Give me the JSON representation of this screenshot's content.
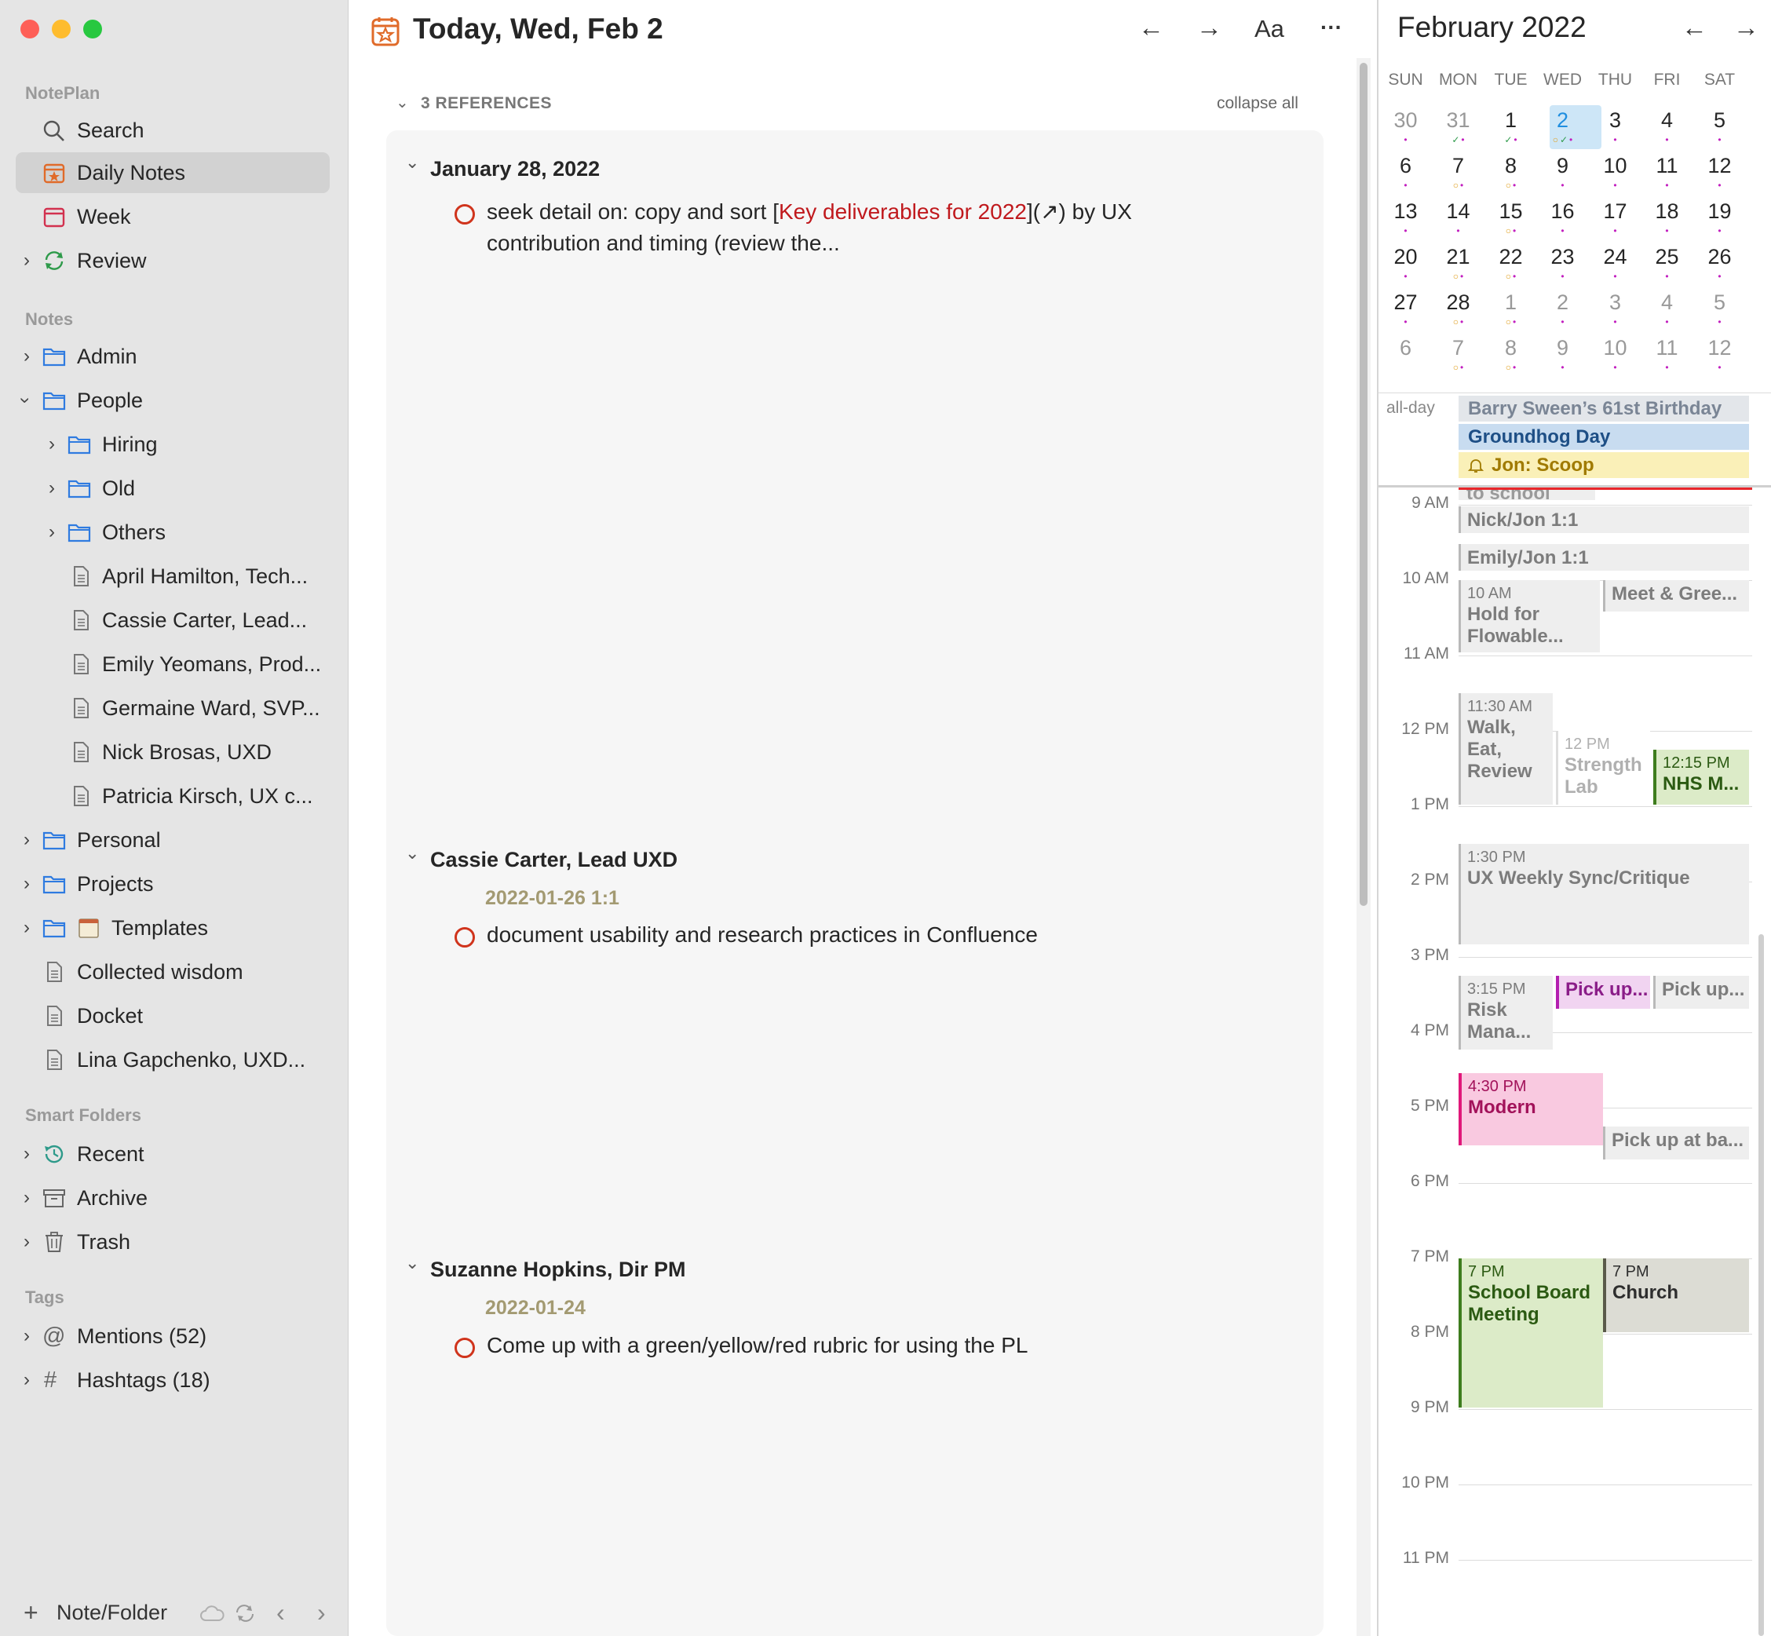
{
  "sidebar": {
    "app_section": "NotePlan",
    "top_items": [
      {
        "label": "Search"
      },
      {
        "label": "Daily Notes"
      },
      {
        "label": "Week"
      },
      {
        "label": "Review"
      }
    ],
    "notes_section": "Notes",
    "note_items": [
      {
        "label": "Admin"
      },
      {
        "label": "People"
      },
      {
        "label": "Hiring"
      },
      {
        "label": "Old"
      },
      {
        "label": "Others"
      },
      {
        "label": "April Hamilton, Tech..."
      },
      {
        "label": "Cassie Carter, Lead..."
      },
      {
        "label": "Emily Yeomans, Prod..."
      },
      {
        "label": "Germaine Ward, SVP..."
      },
      {
        "label": "Nick Brosas, UXD"
      },
      {
        "label": "Patricia Kirsch, UX c..."
      },
      {
        "label": "Personal"
      },
      {
        "label": "Projects"
      },
      {
        "label": "Templates"
      },
      {
        "label": "Collected wisdom"
      },
      {
        "label": "Docket"
      },
      {
        "label": "Lina Gapchenko, UXD..."
      }
    ],
    "smart_section": "Smart Folders",
    "smart_items": [
      {
        "label": "Recent"
      },
      {
        "label": "Archive"
      },
      {
        "label": "Trash"
      }
    ],
    "tags_section": "Tags",
    "tag_items": [
      {
        "label": "Mentions (52)"
      },
      {
        "label": "Hashtags (18)"
      }
    ],
    "footer_label": "Note/Folder"
  },
  "main": {
    "title": "Today, Wed, Feb 2",
    "font_button": "Aa",
    "more_button": "···",
    "references_label": "3 REFERENCES",
    "collapse_all": "collapse all",
    "refs": [
      {
        "heading": "January 28, 2022",
        "task_prefix": "seek detail on: copy and sort [",
        "task_link": "Key deliverables for 2022",
        "task_suffix": "](↗) by UX",
        "task_line2": "contribution and timing (review the..."
      },
      {
        "heading": "Cassie Carter, Lead UXD",
        "date": "2022-01-26 1:1",
        "task": "document usability and research practices in Confluence"
      },
      {
        "heading": "Suzanne Hopkins, Dir PM",
        "date": "2022-01-24",
        "task": "Come up with a green/yellow/red rubric for using the PL"
      }
    ]
  },
  "calendar": {
    "month": "February 2022",
    "dow": [
      "SUN",
      "MON",
      "TUE",
      "WED",
      "THU",
      "FRI",
      "SAT"
    ],
    "weeks": [
      [
        "30",
        "31",
        "1",
        "2",
        "3",
        "4",
        "5"
      ],
      [
        "6",
        "7",
        "8",
        "9",
        "10",
        "11",
        "12"
      ],
      [
        "13",
        "14",
        "15",
        "16",
        "17",
        "18",
        "19"
      ],
      [
        "20",
        "21",
        "22",
        "23",
        "24",
        "25",
        "26"
      ],
      [
        "27",
        "28",
        "1",
        "2",
        "3",
        "4",
        "5"
      ],
      [
        "6",
        "7",
        "8",
        "9",
        "10",
        "11",
        "12"
      ]
    ],
    "today": "2",
    "allday_label": "all-day",
    "allday_events": [
      {
        "title": "Barry Sween’s 61st Birthday"
      },
      {
        "title": "Groundhog Day"
      },
      {
        "title": "Jon: Scoop"
      }
    ],
    "partial_event": "to school",
    "hours": [
      "9 AM",
      "10 AM",
      "11 AM",
      "12 PM",
      "1 PM",
      "2 PM",
      "3 PM",
      "4 PM",
      "5 PM",
      "6 PM",
      "7 PM",
      "8 PM",
      "9 PM",
      "10 PM",
      "11 PM"
    ],
    "events": [
      {
        "time": "",
        "title": "Nick/Jon 1:1"
      },
      {
        "time": "",
        "title": "Emily/Jon 1:1"
      },
      {
        "time": "10 AM",
        "title": "Hold for Flowable..."
      },
      {
        "time": "",
        "title": "Meet & Gree..."
      },
      {
        "time": "11:30 AM",
        "title": "Walk, Eat, Review"
      },
      {
        "time": "12 PM",
        "title": "Strength Lab"
      },
      {
        "time": "12:15 PM",
        "title": "NHS M..."
      },
      {
        "time": "1:30 PM",
        "title": "UX Weekly Sync/Critique"
      },
      {
        "time": "3:15 PM",
        "title": "Risk Mana..."
      },
      {
        "time": "",
        "title": "Pick up..."
      },
      {
        "time": "",
        "title": "Pick up..."
      },
      {
        "time": "4:30 PM",
        "title": "Modern"
      },
      {
        "time": "",
        "title": "Pick up at ba..."
      },
      {
        "time": "7 PM",
        "title": "School Board Meeting"
      },
      {
        "time": "7 PM",
        "title": "Church"
      }
    ]
  },
  "colors": {
    "accent_orange": "#e06b2a",
    "task_red": "#d0341c",
    "link_red": "#c0191d",
    "today_blue": "#cde6f7",
    "event_pink": "#f9c9e0",
    "event_green": "#dcebc8",
    "event_purple": "#f1d4f1"
  }
}
